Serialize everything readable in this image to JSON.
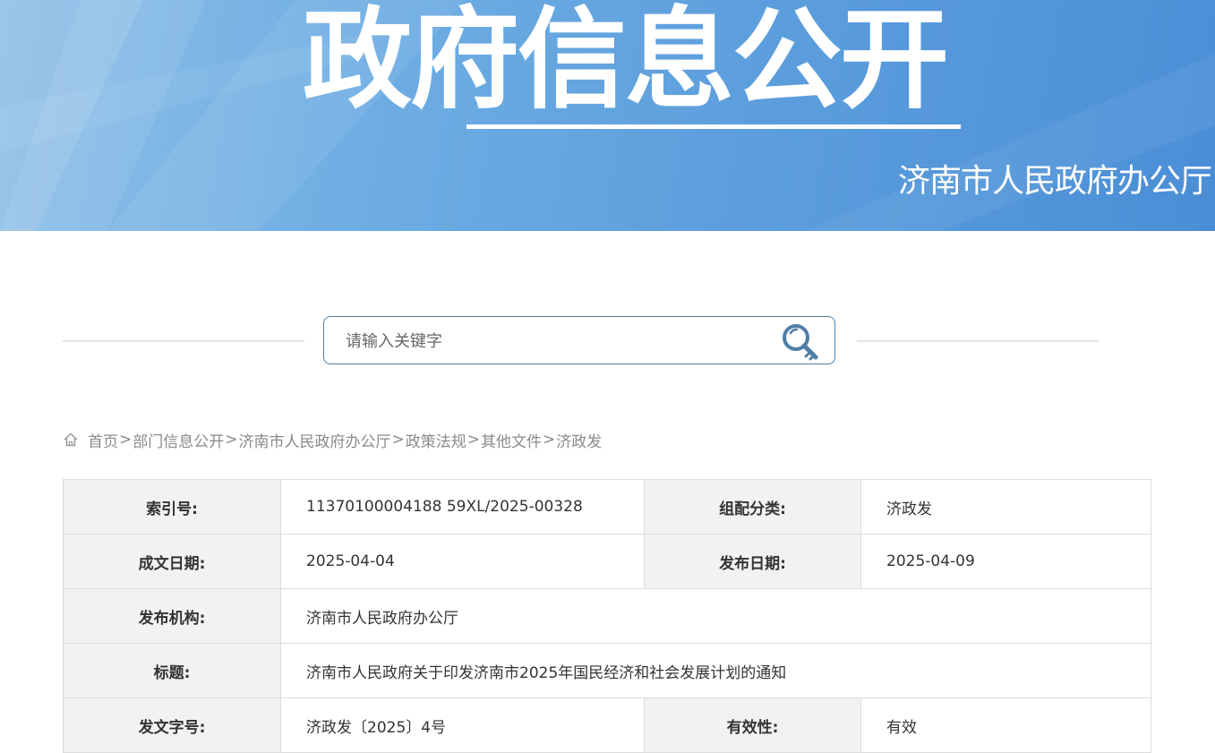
{
  "banner": {
    "title": "政府信息公开",
    "org": "济南市人民政府办公厅"
  },
  "search": {
    "placeholder": "请输入关键字",
    "value": ""
  },
  "breadcrumb": {
    "items": [
      "首页",
      "部门信息公开",
      "济南市人民政府办公厅",
      "政策法规",
      "其他文件",
      "济政发"
    ],
    "separator": ">"
  },
  "meta": {
    "index_label": "索引号:",
    "index_value": "11370100004188 59XL/2025-00328",
    "category_label": "组配分类:",
    "category_value": "济政发",
    "written_date_label": "成文日期:",
    "written_date_value": "2025-04-04",
    "publish_date_label": "发布日期:",
    "publish_date_value": "2025-04-09",
    "publisher_label": "发布机构:",
    "publisher_value": "济南市人民政府办公厅",
    "title_label": "标题:",
    "title_value": "济南市人民政府关于印发济南市2025年国民经济和社会发展计划的通知",
    "doc_number_label": "发文字号:",
    "doc_number_value": "济政发〔2025〕4号",
    "validity_label": "有效性:",
    "validity_value": "有效"
  },
  "icons": {
    "search": "search-icon",
    "home": "home-icon"
  },
  "colors": {
    "banner_blue": "#5d9fdd",
    "search_border": "#4e7ea6",
    "label_bg": "#f2f2f2",
    "breadcrumb_text": "#8a8a8a"
  }
}
